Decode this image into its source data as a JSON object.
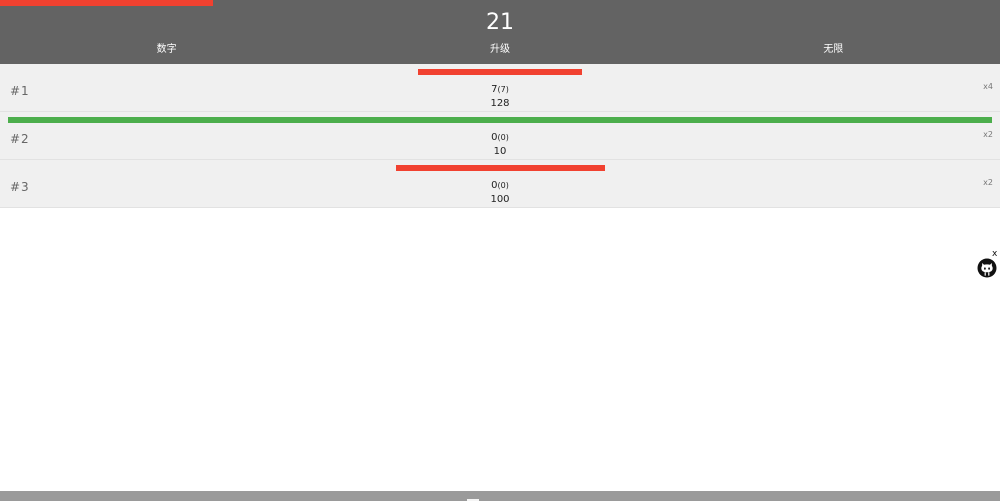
{
  "header": {
    "count": "21",
    "progress_fraction": 0.213,
    "progress_color": "#f14130",
    "background": "#636363"
  },
  "tabs": [
    {
      "label": "数字"
    },
    {
      "label": "升级"
    },
    {
      "label": "无限"
    }
  ],
  "rows": [
    {
      "index": "#1",
      "value": "7",
      "value_sub": "(7)",
      "target": "128",
      "multiplier": "x4",
      "bar_color": "#f14130",
      "bar_fraction": 0.164
    },
    {
      "index": "#2",
      "value": "0",
      "value_sub": "(0)",
      "target": "10",
      "multiplier": "x2",
      "bar_color": "#4cae4c",
      "bar_fraction": 0.984
    },
    {
      "index": "#3",
      "value": "0",
      "value_sub": "(0)",
      "target": "100",
      "multiplier": "x2",
      "bar_color": "#f14130",
      "bar_fraction": 0.209
    }
  ],
  "side_widget": {
    "close_label": "x",
    "icon": "github-octocat-icon"
  },
  "footer": {
    "icon": "drawer-handle-icon"
  }
}
